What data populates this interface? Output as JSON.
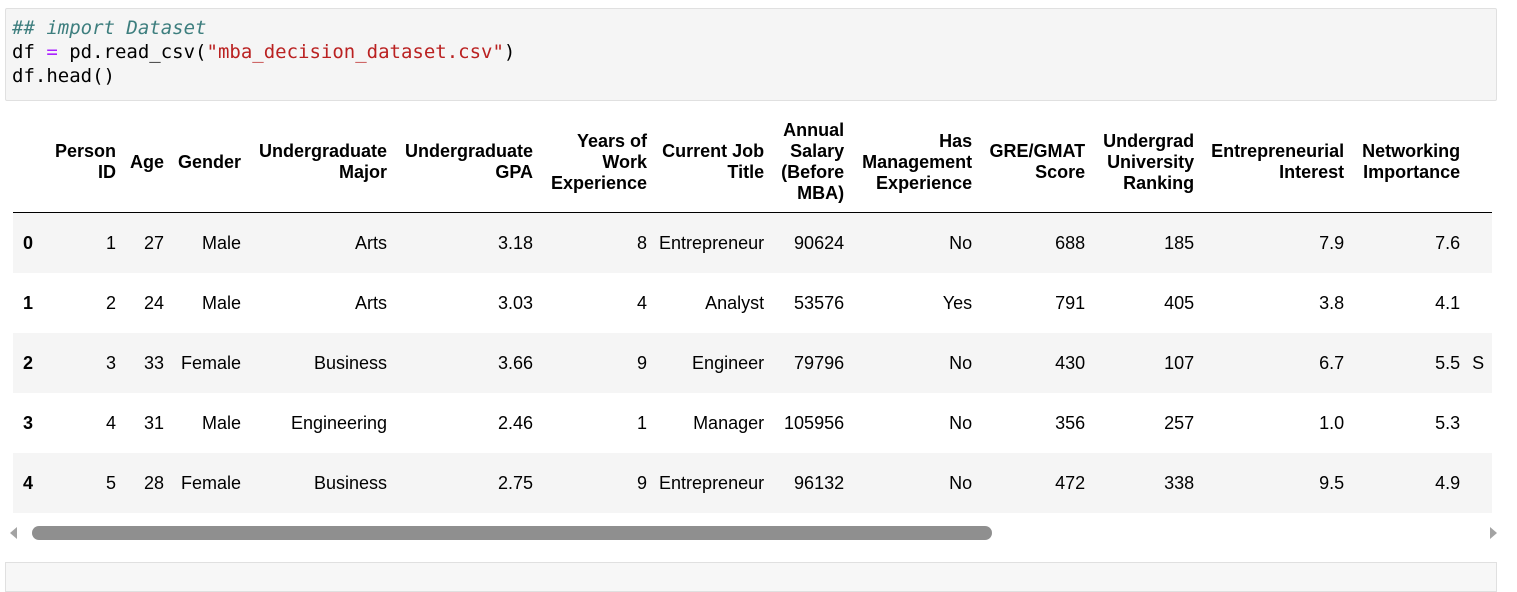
{
  "code_cell": {
    "line1_comment": "## import Dataset",
    "line2_a": "df ",
    "line2_op": "=",
    "line2_b": " pd.read_csv(",
    "line2_str": "\"mba_decision_dataset.csv\"",
    "line2_c": ")",
    "line3": "df.head()"
  },
  "dataframe": {
    "columns": [
      "",
      "Person ID",
      "Age",
      "Gender",
      "Undergraduate Major",
      "Undergraduate GPA",
      "Years of Work Experience",
      "Current Job Title",
      "Annual Salary (Before MBA)",
      "Has Management Experience",
      "GRE/GMAT Score",
      "Undergrad University Ranking",
      "Entrepreneurial Interest",
      "Networking Importance",
      "S"
    ],
    "rows": [
      [
        "0",
        "1",
        "27",
        "Male",
        "Arts",
        "3.18",
        "8",
        "Entrepreneur",
        "90624",
        "No",
        "688",
        "185",
        "7.9",
        "7.6",
        ""
      ],
      [
        "1",
        "2",
        "24",
        "Male",
        "Arts",
        "3.03",
        "4",
        "Analyst",
        "53576",
        "Yes",
        "791",
        "405",
        "3.8",
        "4.1",
        ""
      ],
      [
        "2",
        "3",
        "33",
        "Female",
        "Business",
        "3.66",
        "9",
        "Engineer",
        "79796",
        "No",
        "430",
        "107",
        "6.7",
        "5.5",
        "S"
      ],
      [
        "3",
        "4",
        "31",
        "Male",
        "Engineering",
        "2.46",
        "1",
        "Manager",
        "105956",
        "No",
        "356",
        "257",
        "1.0",
        "5.3",
        ""
      ],
      [
        "4",
        "5",
        "28",
        "Female",
        "Business",
        "2.75",
        "9",
        "Entrepreneur",
        "96132",
        "No",
        "472",
        "338",
        "9.5",
        "4.9",
        ""
      ]
    ]
  },
  "scrollbar": {
    "horizontal_position_fraction": 0.0
  },
  "colors": {
    "comment": "#3d7e7e",
    "operator": "#aa22ff",
    "string": "#ba2121",
    "code_background": "#f5f5f5",
    "row_stripe": "#f5f5f5"
  }
}
